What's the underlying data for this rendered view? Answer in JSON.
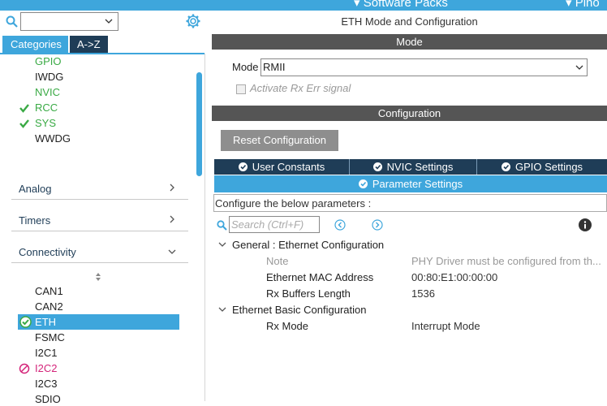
{
  "topbar": {
    "software_packs": "Software Packs",
    "pinout": "Pino"
  },
  "left": {
    "tabs": {
      "categories": "Categories",
      "az": "A->Z"
    },
    "system_items": [
      {
        "label": "GPIO",
        "state": "green"
      },
      {
        "label": "IWDG",
        "state": "normal"
      },
      {
        "label": "NVIC",
        "state": "green"
      },
      {
        "label": "RCC",
        "state": "check"
      },
      {
        "label": "SYS",
        "state": "check"
      },
      {
        "label": "WWDG",
        "state": "normal"
      }
    ],
    "sections": {
      "analog": "Analog",
      "timers": "Timers",
      "connectivity": "Connectivity"
    },
    "connectivity_items": [
      {
        "label": "CAN1",
        "state": "normal"
      },
      {
        "label": "CAN2",
        "state": "normal"
      },
      {
        "label": "ETH",
        "state": "selected"
      },
      {
        "label": "FSMC",
        "state": "normal"
      },
      {
        "label": "I2C1",
        "state": "normal"
      },
      {
        "label": "I2C2",
        "state": "conflict"
      },
      {
        "label": "I2C3",
        "state": "normal"
      },
      {
        "label": "SDIO",
        "state": "normal"
      }
    ]
  },
  "right": {
    "title": "ETH Mode and Configuration",
    "mode_header": "Mode",
    "mode_label": "Mode",
    "mode_value": "RMII",
    "activate_rx_err": "Activate Rx Err signal",
    "config_header": "Configuration",
    "reset_button": "Reset Configuration",
    "tabs": {
      "user_constants": "User Constants",
      "nvic": "NVIC Settings",
      "gpio": "GPIO Settings",
      "parameter": "Parameter Settings"
    },
    "configure_text": "Configure the below parameters :",
    "search_placeholder": "Search (Ctrl+F)",
    "groups": {
      "general": "General : Ethernet Configuration",
      "basic": "Ethernet Basic Configuration"
    },
    "params": [
      {
        "name": "Note",
        "value": "PHY Driver must be configured from th..."
      },
      {
        "name": "Ethernet MAC Address",
        "value": "00:80:E1:00:00:00"
      },
      {
        "name": "Rx Buffers Length",
        "value": "1536"
      },
      {
        "name": "Rx Mode",
        "value": "Interrupt Mode"
      }
    ]
  },
  "colors": {
    "accent": "#3ea6dc",
    "dark": "#1f3d57",
    "green": "#3aaa45",
    "conflict": "#d4247a"
  }
}
